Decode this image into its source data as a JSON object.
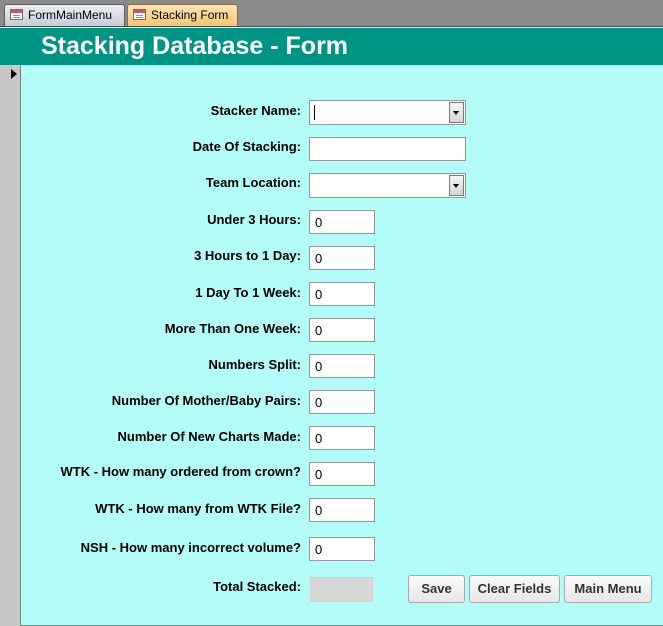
{
  "tabs": [
    {
      "label": "FormMainMenu",
      "icon": "form-icon",
      "active": false
    },
    {
      "label": "Stacking Form",
      "icon": "form-icon",
      "active": true
    }
  ],
  "form": {
    "title": "Stacking Database - Form",
    "colors": {
      "header": "#009484",
      "background": "#b4fcf8",
      "title_text": "#ffffff"
    },
    "fields": {
      "stacker_name": {
        "label": "Stacker Name:",
        "value": ""
      },
      "date_of_stacking": {
        "label": "Date Of Stacking:",
        "value": ""
      },
      "team_location": {
        "label": "Team Location:",
        "value": ""
      },
      "under_3_hours": {
        "label": "Under 3 Hours:",
        "value": "0"
      },
      "hours3_to_1day": {
        "label": "3 Hours to 1 Day:",
        "value": "0"
      },
      "day1_to_1week": {
        "label": "1 Day To 1 Week:",
        "value": "0"
      },
      "more_than_one_week": {
        "label": "More Than One Week:",
        "value": "0"
      },
      "numbers_split": {
        "label": "Numbers Split:",
        "value": "0"
      },
      "mother_baby_pairs": {
        "label": "Number Of Mother/Baby Pairs:",
        "value": "0"
      },
      "new_charts_made": {
        "label": "Number Of New Charts Made:",
        "value": "0"
      },
      "wtk_ordered_from_crown": {
        "label": "WTK - How many ordered from crown?",
        "value": "0"
      },
      "wtk_from_wtk_file": {
        "label": "WTK - How many from WTK File?",
        "value": "0"
      },
      "nsh_incorrect_volume": {
        "label": "NSH - How many incorrect volume?",
        "value": "0"
      },
      "total_stacked": {
        "label": "Total Stacked:",
        "value": ""
      }
    },
    "buttons": {
      "save": "Save",
      "clear_fields": "Clear Fields",
      "main_menu": "Main Menu"
    }
  }
}
